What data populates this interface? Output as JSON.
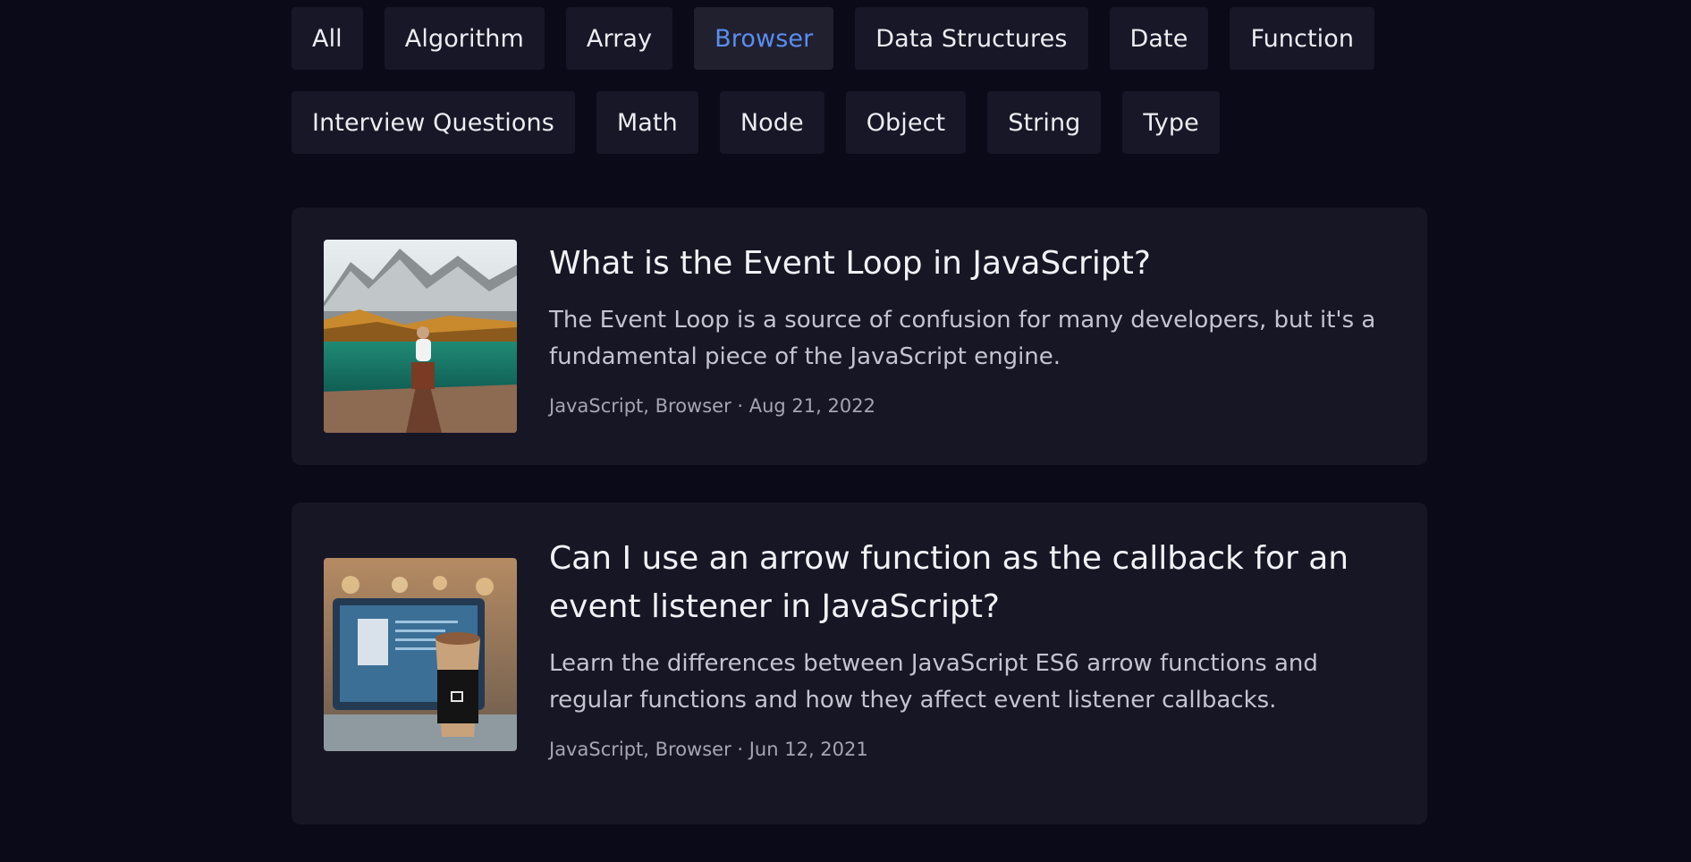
{
  "filters": {
    "items": [
      {
        "label": "All",
        "active": false
      },
      {
        "label": "Algorithm",
        "active": false
      },
      {
        "label": "Array",
        "active": false
      },
      {
        "label": "Browser",
        "active": true
      },
      {
        "label": "Data Structures",
        "active": false
      },
      {
        "label": "Date",
        "active": false
      },
      {
        "label": "Function",
        "active": false
      },
      {
        "label": "Interview Questions",
        "active": false
      },
      {
        "label": "Math",
        "active": false
      },
      {
        "label": "Node",
        "active": false
      },
      {
        "label": "Object",
        "active": false
      },
      {
        "label": "String",
        "active": false
      },
      {
        "label": "Type",
        "active": false
      }
    ],
    "active_color": "#5b8ef0"
  },
  "posts": [
    {
      "title": "What is the Event Loop in JavaScript?",
      "description": "The Event Loop is a source of confusion for many developers, but it's a fundamental piece of the JavaScript engine.",
      "meta": "JavaScript, Browser · Aug 21, 2022",
      "image": "mountain-lake-photo"
    },
    {
      "title": "Can I use an arrow function as the callback for an event listener in JavaScript?",
      "description": "Learn the differences between JavaScript ES6 arrow functions and regular functions and how they affect event listener callbacks.",
      "meta": "JavaScript, Browser · Jun 12, 2021",
      "image": "coffee-laptop-photo"
    }
  ]
}
